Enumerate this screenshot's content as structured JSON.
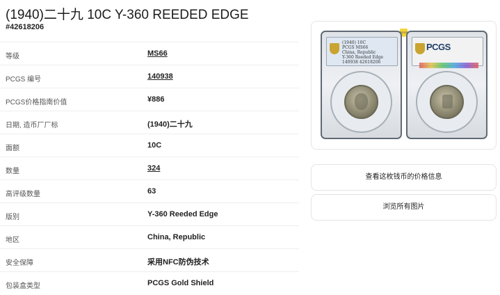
{
  "page": {
    "title": "(1940)二十九 10C Y-360 REEDED EDGE",
    "cert_number": "#42618206"
  },
  "details": [
    {
      "label": "等级",
      "value": "MS66",
      "link": true
    },
    {
      "label": "PCGS 编号",
      "value": "140938",
      "link": true
    },
    {
      "label": "PCGS价格指南价值",
      "value": "¥886",
      "link": false
    },
    {
      "label": "日期, 造币厂厂标",
      "value": "(1940)二十九",
      "link": false
    },
    {
      "label": "面额",
      "value": "10C",
      "link": false
    },
    {
      "label": "数量",
      "value": "324",
      "link": true
    },
    {
      "label": "高评级数量",
      "value": "63",
      "link": false
    },
    {
      "label": "版别",
      "value": "Y-360 Reeded Edge",
      "link": false
    },
    {
      "label": "地区",
      "value": "China, Republic",
      "link": false
    },
    {
      "label": "安全保障",
      "value": "采用NFC防伪技术",
      "link": false
    },
    {
      "label": "包装盒类型",
      "value": "PCGS Gold Shield",
      "link": false
    }
  ],
  "slab": {
    "front_label_lines": [
      "(1940) 10C",
      "PCGS MS66",
      "China, Republic",
      "Y-360 Reeded Edge",
      "140938 42618206"
    ],
    "back_logo": "PCGS"
  },
  "actions": {
    "price_info": "查看这枚钱币的价格信息",
    "view_images": "浏览所有图片"
  }
}
